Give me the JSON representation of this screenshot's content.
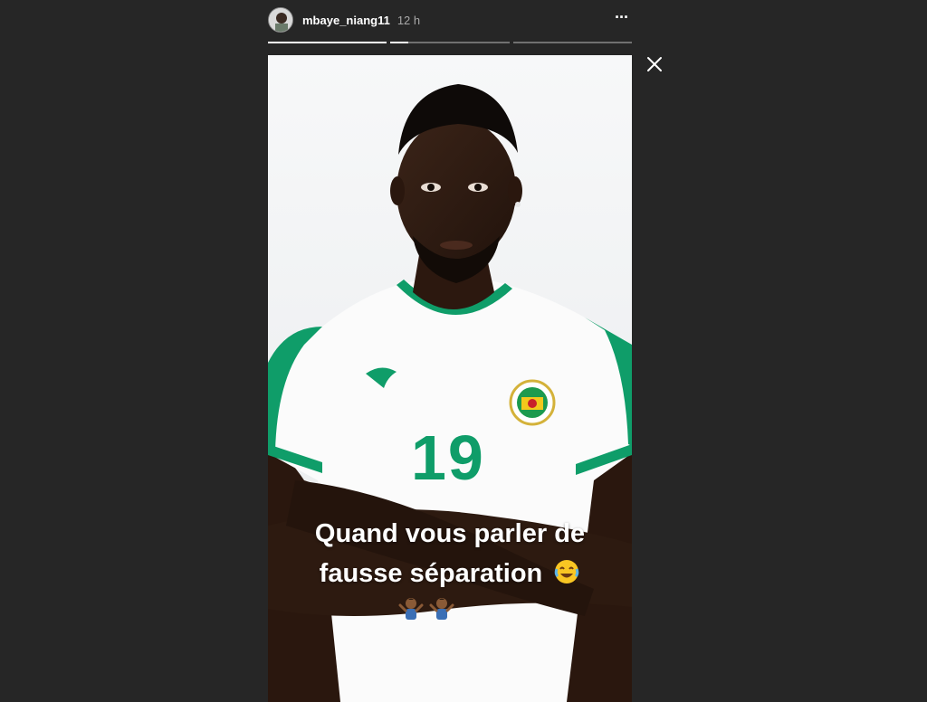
{
  "story": {
    "username": "mbaye_niang11",
    "time": "12 h",
    "more_label": "···",
    "progress": [
      1.0,
      0.15,
      0.0
    ],
    "caption_line1": "Quand vous parler de",
    "caption_line2": "fausse séparation",
    "jersey_number": "19",
    "caption_emoji": "joy-emoji",
    "shrug_emojis": [
      "person-shrugging-emoji",
      "person-shrugging-emoji"
    ]
  },
  "icons": {
    "close": "close-icon",
    "more": "more-options-icon"
  },
  "colors": {
    "background": "#262626",
    "jersey_trim": "#0f9d69",
    "text": "#ffffff"
  }
}
